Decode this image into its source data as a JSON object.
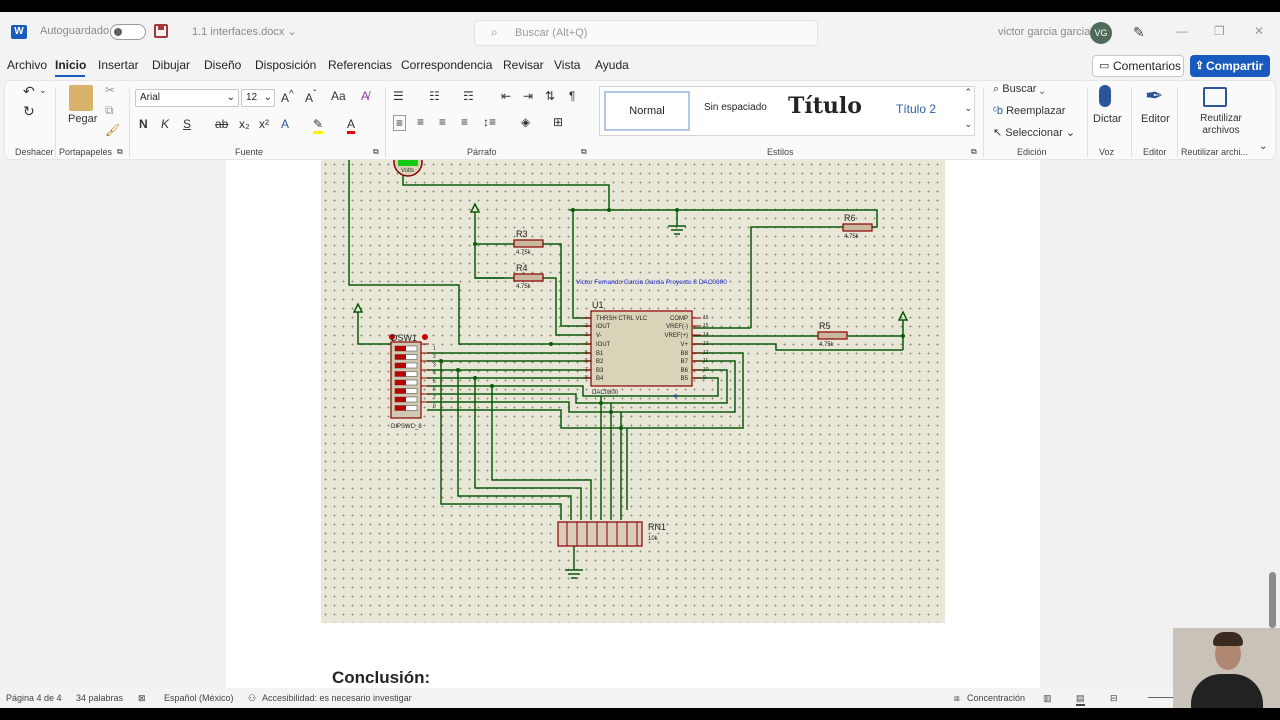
{
  "title_bar": {
    "autosave_label": "Autoguardado",
    "document_name": "1.1 interfaces.docx",
    "search_placeholder": "Buscar (Alt+Q)",
    "user_name": "victor garcia garcia",
    "user_initials": "VG"
  },
  "menu": {
    "items": [
      "Archivo",
      "Inicio",
      "Insertar",
      "Dibujar",
      "Diseño",
      "Disposición",
      "Referencias",
      "Correspondencia",
      "Revisar",
      "Vista",
      "Ayuda"
    ],
    "active": "Inicio",
    "comments_label": "Comentarios",
    "share_label": "Compartir"
  },
  "ribbon": {
    "font_name": "Arial",
    "font_size": "12",
    "paste_label": "Pegar",
    "styles": {
      "normal": "Normal",
      "no_spacing": "Sin espaciado",
      "title": "Título",
      "title2": "Título 2"
    },
    "find_label": "Buscar",
    "replace_label": "Reemplazar",
    "select_label": "Seleccionar",
    "dictate_label": "Dictar",
    "editor_label": "Editor",
    "reuse_label": "Reutilizar archivos",
    "groups": {
      "undo": "Deshacer",
      "clipboard": "Portapapeles",
      "font": "Fuente",
      "paragraph": "Párrafo",
      "styles": "Estilos",
      "editing": "Edición",
      "voice": "Voz",
      "editor": "Editor",
      "reuse": "Reutilizar archi..."
    }
  },
  "schematic": {
    "voltmeter_label": "Volts",
    "r3": {
      "name": "R3",
      "value": "4.75k"
    },
    "r4": {
      "name": "R4",
      "value": "4.75k"
    },
    "r5": {
      "name": "R5",
      "value": "4.75k"
    },
    "r6": {
      "name": "R6",
      "value": "4.75k"
    },
    "caption": "Victor Fernando  Garcia Garcia Proyecto 8 DAC0800",
    "u1_name": "U1",
    "u1_part": "DAC0800",
    "u1_left_pins": [
      "THRSH CTRL VLC",
      "IOUT",
      "V-",
      "IOUT",
      "B1",
      "B2",
      "B3",
      "B4"
    ],
    "u1_left_nums": [
      "2",
      "3",
      "4",
      "5",
      "6",
      "7",
      "8"
    ],
    "u1_right_pins": [
      "COMP",
      "VREF(-)",
      "VREF(+)",
      "V+",
      "B8",
      "B7",
      "B6",
      "B5"
    ],
    "u1_right_nums": [
      "16",
      "15",
      "14",
      "13",
      "12",
      "11",
      "10",
      "9"
    ],
    "dsw_name": "DSW1",
    "dsw_part": "DIPSWC_8",
    "dsw_numbers": [
      "1",
      "2",
      "3",
      "4",
      "5",
      "6",
      "7",
      "8"
    ],
    "rn1_name": "RN1",
    "rn1_value": "10k"
  },
  "document": {
    "conclusion_heading": "Conclusión:"
  },
  "status": {
    "page": "Página 4 de 4",
    "words": "34 palabras",
    "language": "Español (México)",
    "accessibility": "Accesibilidad: es necesario investigar",
    "focus": "Concentración"
  }
}
